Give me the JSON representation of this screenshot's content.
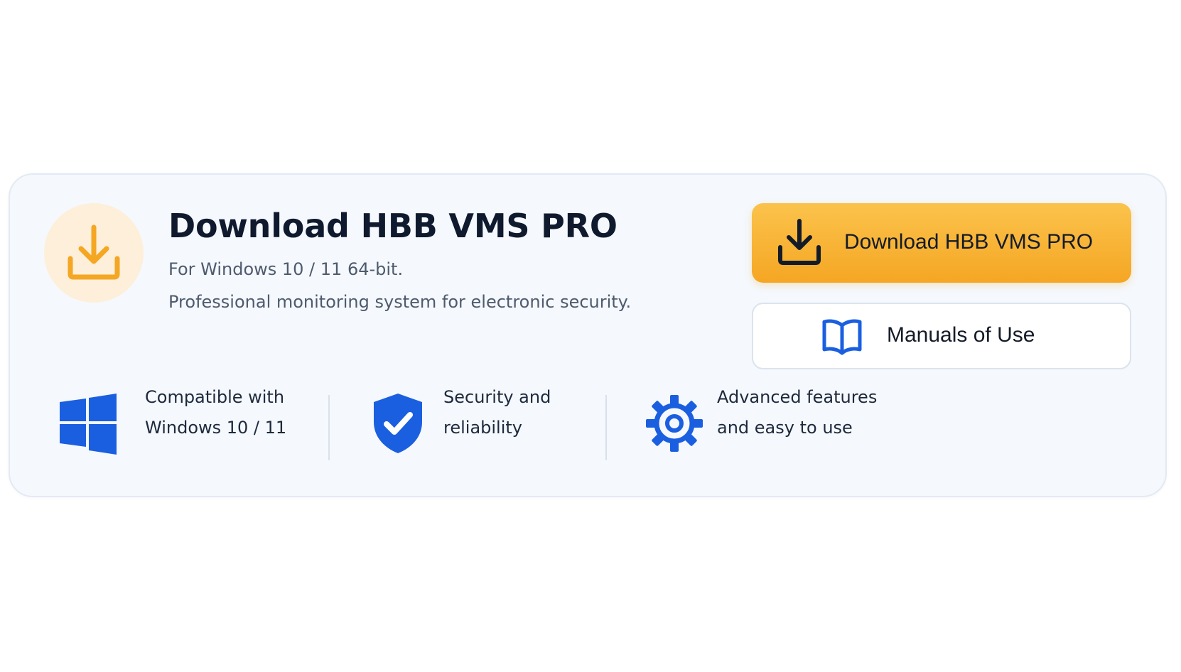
{
  "colors": {
    "accent_orange": "#f5a623",
    "accent_blue": "#1a5fe0",
    "title_text": "#0f1a2e",
    "muted_text": "#4e5b6e"
  },
  "header": {
    "icon": "download-icon",
    "title": "Download HBB VMS PRO",
    "subtitle": "For Windows 10 / 11 64-bit.",
    "description": "Professional monitoring system for electronic security."
  },
  "actions": {
    "download": {
      "icon": "download-icon",
      "label": "Download HBB VMS PRO"
    },
    "manuals": {
      "icon": "book-icon",
      "label": "Manuals of Use"
    }
  },
  "features": [
    {
      "icon": "windows-icon",
      "line1": "Compatible with",
      "line2": "Windows 10 / 11"
    },
    {
      "icon": "shield-check-icon",
      "line1": "Security and",
      "line2": "reliability"
    },
    {
      "icon": "gear-icon",
      "line1": "Advanced features",
      "line2": "and easy to use"
    }
  ]
}
